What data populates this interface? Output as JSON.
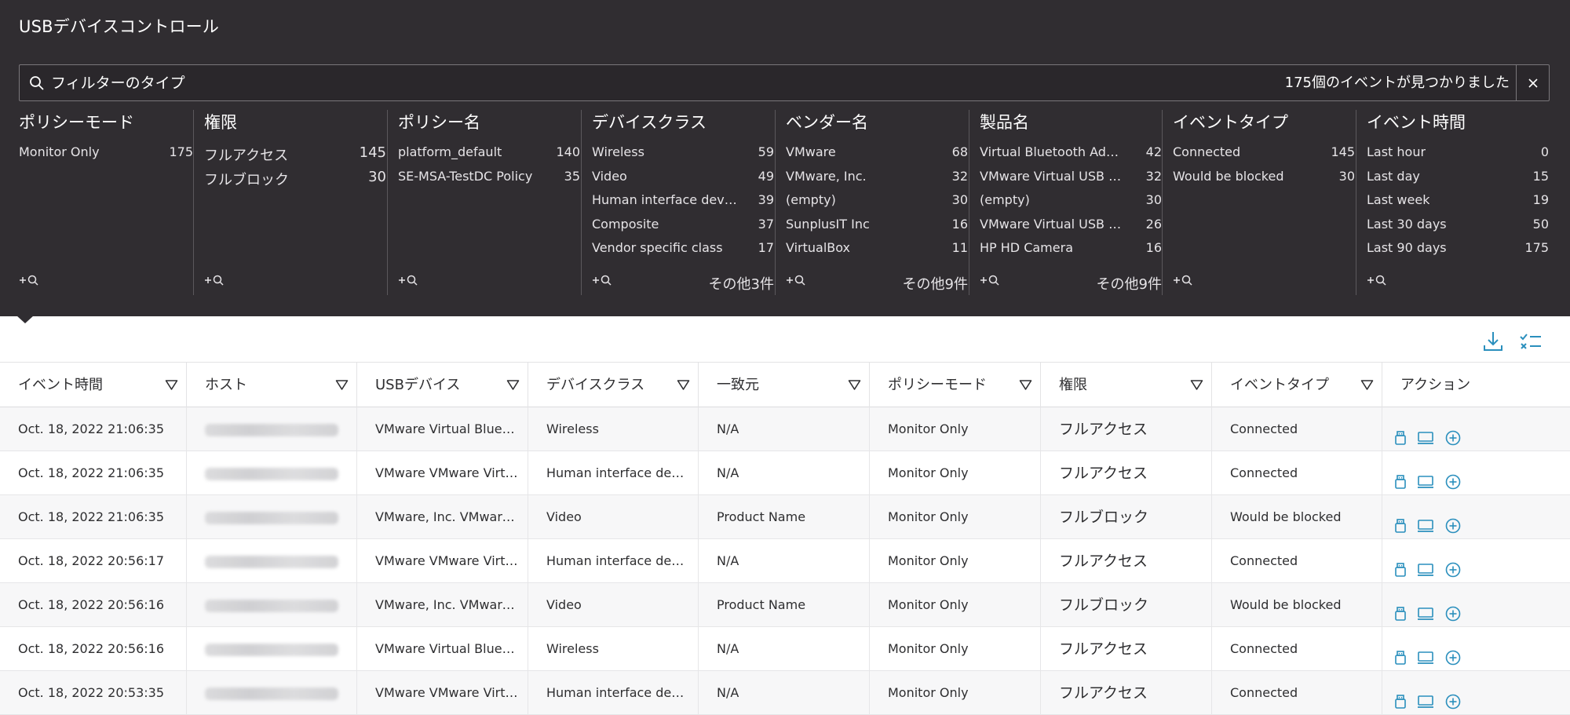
{
  "panel": {
    "title": "USBデバイスコントロール",
    "search_placeholder": "フィルターのタイプ",
    "result_count": "175個のイベントが見つかりました"
  },
  "facets": [
    {
      "title": "ポリシーモード",
      "items": [
        {
          "label": "Monitor Only",
          "count": "175"
        }
      ],
      "more": ""
    },
    {
      "title": "権限",
      "items": [
        {
          "label": "フルアクセス",
          "count": "145"
        },
        {
          "label": "フルブロック",
          "count": "30"
        }
      ],
      "more": ""
    },
    {
      "title": "ポリシー名",
      "items": [
        {
          "label": "platform_default",
          "count": "140"
        },
        {
          "label": "SE-MSA-TestDC Policy",
          "count": "35"
        }
      ],
      "more": ""
    },
    {
      "title": "デバイスクラス",
      "items": [
        {
          "label": "Wireless",
          "count": "59"
        },
        {
          "label": "Video",
          "count": "49"
        },
        {
          "label": "Human interface device",
          "count": "39"
        },
        {
          "label": "Composite",
          "count": "37"
        },
        {
          "label": "Vendor specific class",
          "count": "17"
        }
      ],
      "more": "その他3件"
    },
    {
      "title": "ベンダー名",
      "items": [
        {
          "label": "VMware",
          "count": "68"
        },
        {
          "label": "VMware, Inc.",
          "count": "32"
        },
        {
          "label": "(empty)",
          "count": "30"
        },
        {
          "label": "SunplusIT Inc",
          "count": "16"
        },
        {
          "label": "VirtualBox",
          "count": "11"
        }
      ],
      "more": "その他9件"
    },
    {
      "title": "製品名",
      "items": [
        {
          "label": "Virtual Bluetooth Adapter",
          "count": "42"
        },
        {
          "label": "VMware Virtual USB Mouse",
          "count": "32"
        },
        {
          "label": "(empty)",
          "count": "30"
        },
        {
          "label": "VMware Virtual USB Keyboard",
          "count": "26"
        },
        {
          "label": "HP HD Camera",
          "count": "16"
        }
      ],
      "more": "その他9件"
    },
    {
      "title": "イベントタイプ",
      "items": [
        {
          "label": "Connected",
          "count": "145"
        },
        {
          "label": "Would be blocked",
          "count": "30"
        }
      ],
      "more": ""
    },
    {
      "title": "イベント時間",
      "items": [
        {
          "label": "Last hour",
          "count": "0"
        },
        {
          "label": "Last day",
          "count": "15"
        },
        {
          "label": "Last week",
          "count": "19"
        },
        {
          "label": "Last 30 days",
          "count": "50"
        },
        {
          "label": "Last 90 days",
          "count": "175"
        }
      ],
      "more": ""
    }
  ],
  "columns": [
    "イベント時間",
    "ホスト",
    "USBデバイス",
    "デバイスクラス",
    "一致元",
    "ポリシーモード",
    "権限",
    "イベントタイプ",
    "アクション"
  ],
  "rows": [
    {
      "time": "Oct. 18, 2022 21:06:35",
      "device": "VMware Virtual Bluetooth Adapter",
      "device_class": "Wireless",
      "matched": "N/A",
      "mode": "Monitor Only",
      "permission": "フルアクセス",
      "event_type": "Connected"
    },
    {
      "time": "Oct. 18, 2022 21:06:35",
      "device": "VMware VMware Virtual USB Mouse",
      "device_class": "Human interface device",
      "matched": "N/A",
      "mode": "Monitor Only",
      "permission": "フルアクセス",
      "event_type": "Connected"
    },
    {
      "time": "Oct. 18, 2022 21:06:35",
      "device": "VMware, Inc. VMware Camera",
      "device_class": "Video",
      "matched": "Product Name",
      "mode": "Monitor Only",
      "permission": "フルブロック",
      "event_type": "Would be blocked"
    },
    {
      "time": "Oct. 18, 2022 20:56:17",
      "device": "VMware VMware Virtual USB Mouse",
      "device_class": "Human interface device",
      "matched": "N/A",
      "mode": "Monitor Only",
      "permission": "フルアクセス",
      "event_type": "Connected"
    },
    {
      "time": "Oct. 18, 2022 20:56:16",
      "device": "VMware, Inc. VMware Camera",
      "device_class": "Video",
      "matched": "Product Name",
      "mode": "Monitor Only",
      "permission": "フルブロック",
      "event_type": "Would be blocked"
    },
    {
      "time": "Oct. 18, 2022 20:56:16",
      "device": "VMware Virtual Bluetooth Adapter",
      "device_class": "Wireless",
      "matched": "N/A",
      "mode": "Monitor Only",
      "permission": "フルアクセス",
      "event_type": "Connected"
    },
    {
      "time": "Oct. 18, 2022 20:53:35",
      "device": "VMware VMware Virtual USB Mouse",
      "device_class": "Human interface device",
      "matched": "N/A",
      "mode": "Monitor Only",
      "permission": "フルアクセス",
      "event_type": "Connected"
    }
  ],
  "icons": {
    "search": "search-icon",
    "clear": "close-icon",
    "add_filter": "add-search-icon",
    "download": "download-icon",
    "column_select": "checklist-icon",
    "column_filter": "filter-icon",
    "row_actions": [
      "device-icon",
      "host-icon",
      "add-circle-icon"
    ]
  },
  "colors": {
    "panel_bg": "#302d31",
    "accent": "#2a8fbd"
  }
}
